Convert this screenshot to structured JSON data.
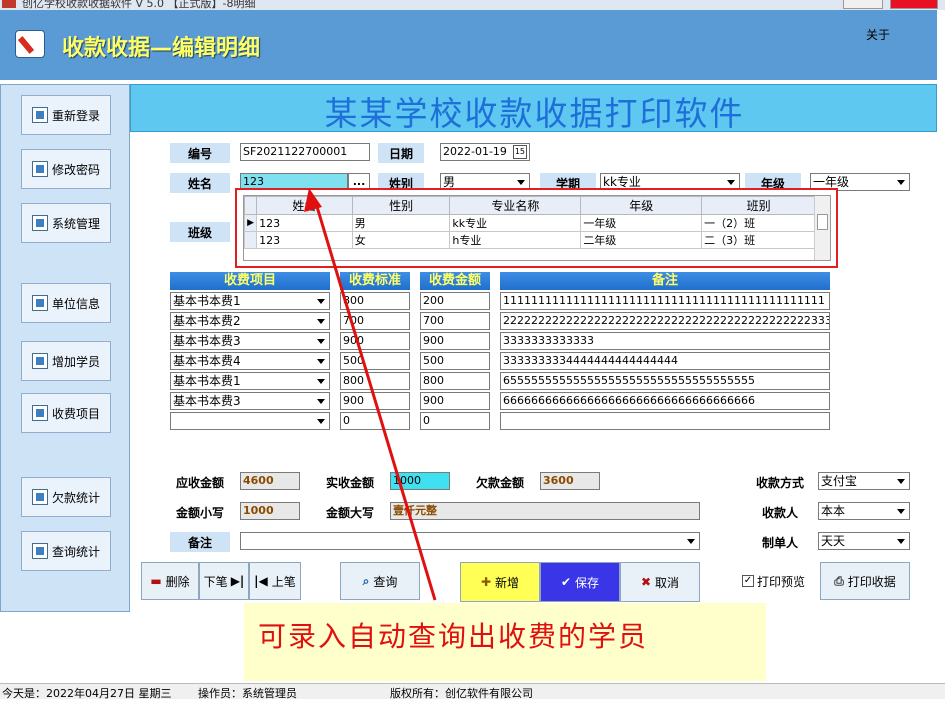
{
  "window": {
    "title": "创亿学校收款收据软件 V 5.0 【正式版】-8明细"
  },
  "header": {
    "title": "收款收据—编辑明细",
    "about": "关于"
  },
  "sidebar": {
    "items": [
      {
        "label": "重新登录"
      },
      {
        "label": "修改密码"
      },
      {
        "label": "系统管理"
      },
      {
        "label": "单位信息"
      },
      {
        "label": "增加学员"
      },
      {
        "label": "收费项目"
      },
      {
        "label": "欠款统计"
      },
      {
        "label": "查询统计"
      }
    ]
  },
  "banner": {
    "title": "某某学校收款收据打印软件"
  },
  "form": {
    "number_label": "编号",
    "number_value": "SF2021122700001",
    "date_label": "日期",
    "date_value": "2022-01-19",
    "date_icon": "15",
    "name_label": "姓名",
    "name_value": "123",
    "name_btn": "...",
    "gender_label": "姓别",
    "gender_value": "男",
    "term_label": "学期",
    "term_value": "kk专业",
    "grade_label": "年级",
    "grade_value": "一年级",
    "class_label": "班级"
  },
  "grid": {
    "headers": [
      "姓名",
      "性别",
      "专业名称",
      "年级",
      "班别"
    ],
    "rows": [
      [
        "123",
        "男",
        "kk专业",
        "一年级",
        "一（2）班"
      ],
      [
        "123",
        "女",
        "h专业",
        "二年级",
        "二（3）班"
      ]
    ]
  },
  "fees": {
    "headers": {
      "item": "收费项目",
      "std": "收费标准",
      "amount": "收费金额",
      "note": "备注"
    },
    "rows": [
      {
        "item": "基本书本费1",
        "std": "800",
        "amount": "200",
        "note": "1111111111111111111111111111111111111111111111"
      },
      {
        "item": "基本书本费2",
        "std": "700",
        "amount": "700",
        "note": "22222222222222222222222222222222222222222222333"
      },
      {
        "item": "基本书本费3",
        "std": "900",
        "amount": "900",
        "note": "3333333333333"
      },
      {
        "item": "基本书本费4",
        "std": "500",
        "amount": "500",
        "note": "3333333334444444444444444"
      },
      {
        "item": "基本书本费1",
        "std": "800",
        "amount": "800",
        "note": "655555555555555555555555555555555555"
      },
      {
        "item": "基本书本费3",
        "std": "900",
        "amount": "900",
        "note": "666666666666666666666666666666666666"
      },
      {
        "item": "",
        "std": "0",
        "amount": "0",
        "note": ""
      }
    ]
  },
  "summary": {
    "due_label": "应收金额",
    "due_value": "4600",
    "paid_label": "实收金额",
    "paid_value": "1000",
    "owed_label": "欠款金额",
    "owed_value": "3600",
    "method_label": "收款方式",
    "method_value": "支付宝",
    "lower_label": "金额小写",
    "lower_value": "1000",
    "upper_label": "金额大写",
    "upper_value": "壹仟元整",
    "payee_label": "收款人",
    "payee_value": "本本",
    "note_label": "备注",
    "note_value": "",
    "maker_label": "制单人",
    "maker_value": "天天"
  },
  "buttons": {
    "delete": "删除",
    "next": "下笔",
    "prev": "上笔",
    "query": "查询",
    "add": "新增",
    "save": "保存",
    "cancel": "取消",
    "preview": "打印预览",
    "print": "打印收据"
  },
  "callout": {
    "text": "可录入自动查询出收费的学员"
  },
  "status": {
    "today": "今天是：2022年04月27日  星期三",
    "operator": "操作员：系统管理员",
    "copyright": "版权所有：创亿软件有限公司"
  }
}
